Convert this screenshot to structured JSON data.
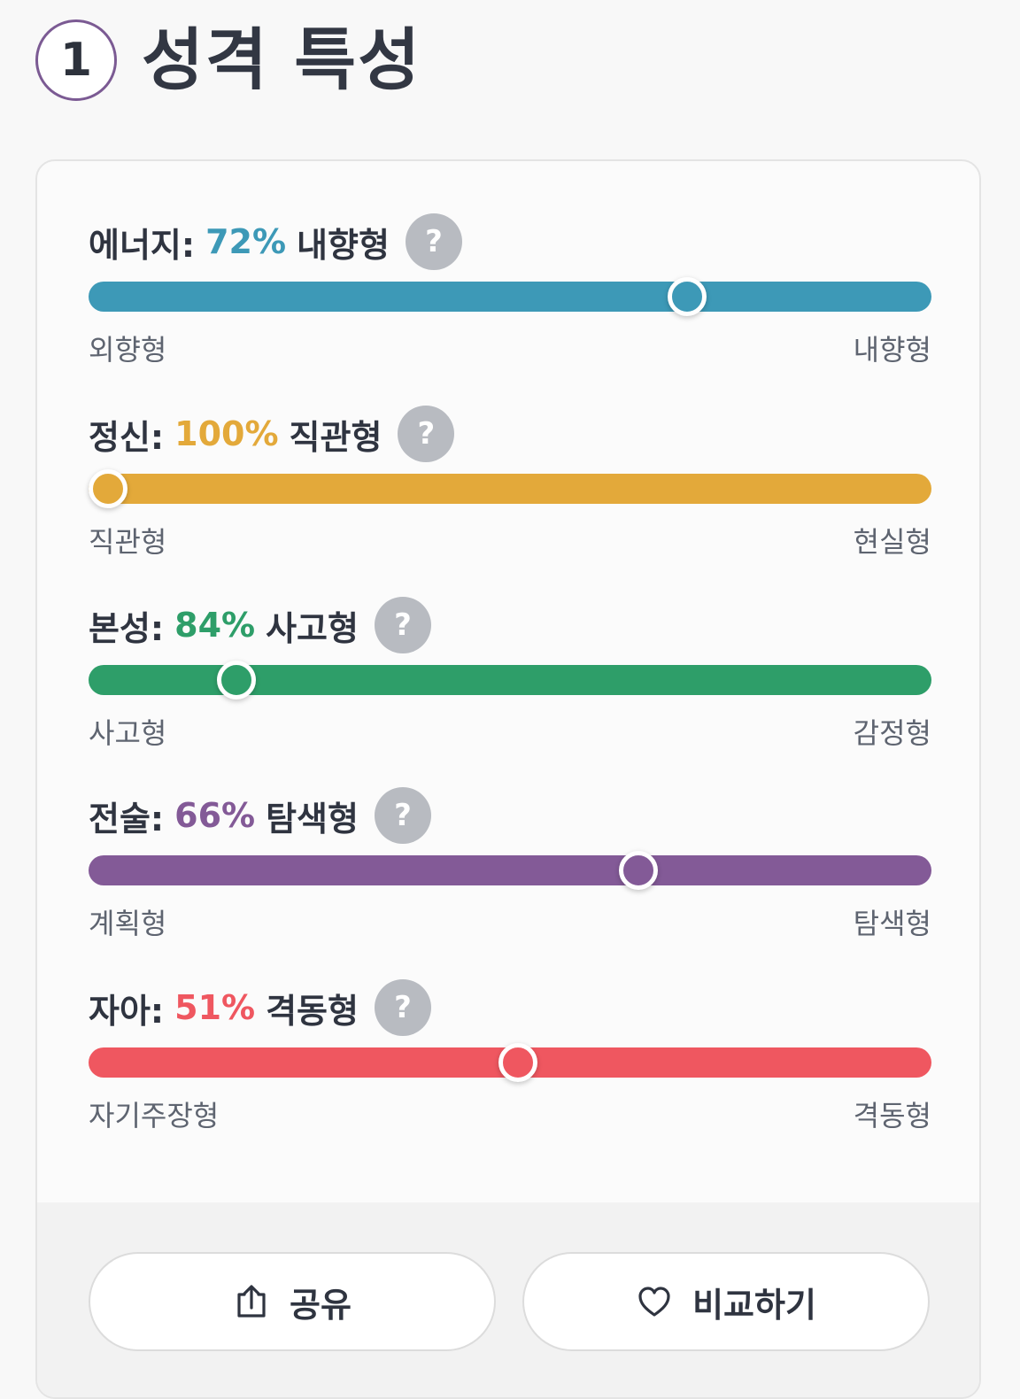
{
  "header": {
    "step_number": "1",
    "title": "성격 특성"
  },
  "traits": [
    {
      "name": "에너지:",
      "percent": "72%",
      "result": "내향형",
      "help_icon": "question-icon",
      "color": "#3d99b7",
      "left_label": "외향형",
      "right_label": "내향형",
      "position_fraction": 0.72
    },
    {
      "name": "정신:",
      "percent": "100%",
      "result": "직관형",
      "help_icon": "question-icon",
      "color": "#e3a93a",
      "left_label": "직관형",
      "right_label": "현실형",
      "position_fraction": 0.0
    },
    {
      "name": "본성:",
      "percent": "84%",
      "result": "사고형",
      "help_icon": "question-icon",
      "color": "#2e9e69",
      "left_label": "사고형",
      "right_label": "감정형",
      "position_fraction": 0.16
    },
    {
      "name": "전술:",
      "percent": "66%",
      "result": "탐색형",
      "help_icon": "question-icon",
      "color": "#835a97",
      "left_label": "계획형",
      "right_label": "탐색형",
      "position_fraction": 0.66
    },
    {
      "name": "자아:",
      "percent": "51%",
      "result": "격동형",
      "help_icon": "question-icon",
      "color": "#ef5760",
      "left_label": "자기주장형",
      "right_label": "격동형",
      "position_fraction": 0.51
    }
  ],
  "actions": {
    "share_label": "공유",
    "compare_label": "비교하기",
    "share_icon": "share-icon",
    "compare_icon": "heart-icon"
  }
}
